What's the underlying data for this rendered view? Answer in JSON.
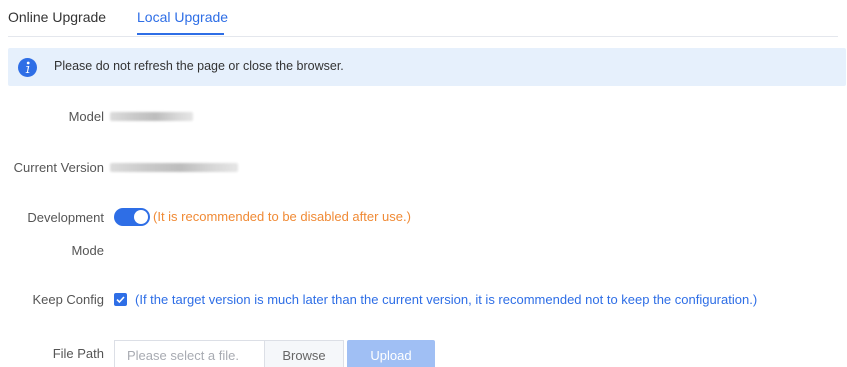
{
  "tabs": [
    {
      "label": "Online Upgrade",
      "active": false
    },
    {
      "label": "Local Upgrade",
      "active": true
    }
  ],
  "notice": {
    "icon": "info-icon",
    "text": "Please do not refresh the page or close the browser."
  },
  "form": {
    "model": {
      "label": "Model",
      "value_redacted": true
    },
    "current_version": {
      "label": "Current Version",
      "value_redacted": true
    },
    "development_mode": {
      "label_line1": "Development",
      "label_line2": "Mode",
      "enabled": true,
      "note": "(It is recommended to be disabled after use.)"
    },
    "keep_config": {
      "label": "Keep Config",
      "checked": true,
      "note": "(If the target version is much later than the current version, it is recommended not to keep the configuration.)"
    },
    "file_path": {
      "label": "File Path",
      "placeholder": "Please select a file.",
      "browse_label": "Browse",
      "upload_label": "Upload"
    }
  },
  "colors": {
    "accent": "#2e6ee6",
    "notice_bg": "#e6f0fc",
    "warning_text": "#f08a35",
    "upload_disabled": "#a0bff4"
  }
}
